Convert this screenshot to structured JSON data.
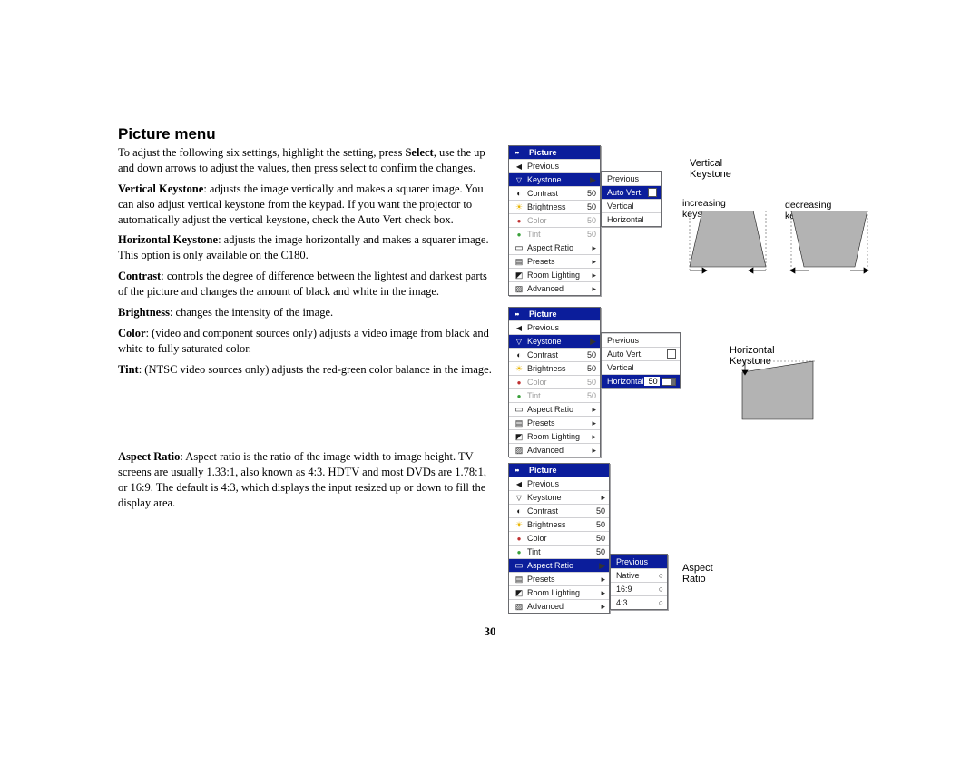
{
  "title": "Picture menu",
  "page_number": "30",
  "paragraphs": {
    "intro_a": "To adjust the following six settings, highlight the setting, press ",
    "intro_b": "Select",
    "intro_c": ", use the up and down arrows to adjust the values, then press select to confirm the changes.",
    "vk_label": "Vertical Keystone",
    "vk_text": ": adjusts the image vertically and makes a squarer image. You can also adjust vertical keystone from the keypad. If you want the projector to automatically adjust the vertical keystone, check the Auto Vert check box.",
    "hk_label": "Horizontal Keystone",
    "hk_text": ": adjusts the image horizontally and makes a squarer image. This option is only available on the C180.",
    "contrast_label": "Contrast",
    "contrast_text": ": controls the degree of difference between the lightest and darkest parts of the picture and changes the amount of black and white in the image.",
    "brightness_label": "Brightness",
    "brightness_text": ": changes the intensity of the image.",
    "color_label": "Color",
    "color_text": ": (video and component sources only) adjusts a video image from black and white to fully saturated color.",
    "tint_label": "Tint",
    "tint_text": ": (NTSC video sources only) adjusts the red-green color balance in the image.",
    "aspect_label": "Aspect Ratio",
    "aspect_text": ": Aspect ratio is the ratio of the image width to image height. TV screens are usually 1.33:1, also known as 4:3. HDTV and most DVDs are 1.78:1, or 16:9. The default is 4:3, which displays the input resized up or down to fill the display area."
  },
  "labels": {
    "vertical_keystone": "Vertical Keystone",
    "increasing": "increasing keystone",
    "decreasing": "decreasing keystone",
    "horizontal_keystone": "Horizontal Keystone",
    "aspect_ratio": "Aspect Ratio"
  },
  "menu": {
    "picture": "Picture",
    "previous": "Previous",
    "keystone": "Keystone",
    "contrast": "Contrast",
    "brightness": "Brightness",
    "color": "Color",
    "tint": "Tint",
    "aspect_ratio": "Aspect Ratio",
    "presets": "Presets",
    "room_lighting": "Room Lighting",
    "advanced": "Advanced",
    "auto_vert": "Auto Vert.",
    "vertical": "Vertical",
    "horizontal": "Horizontal",
    "native": "Native",
    "sixteen_nine": "16:9",
    "four_three": "4:3",
    "val50": "50"
  }
}
